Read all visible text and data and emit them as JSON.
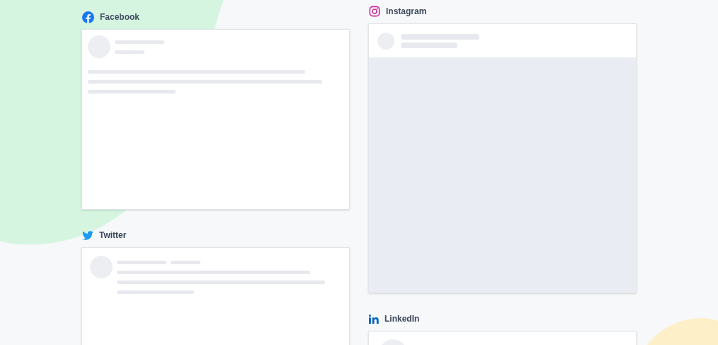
{
  "columns": [
    {
      "sections": [
        {
          "kind": "facebook",
          "label": "Facebook"
        },
        {
          "kind": "twitter",
          "label": "Twitter"
        }
      ]
    },
    {
      "sections": [
        {
          "kind": "instagram",
          "label": "Instagram"
        },
        {
          "kind": "linkedin",
          "label": "LinkedIn"
        }
      ]
    }
  ]
}
